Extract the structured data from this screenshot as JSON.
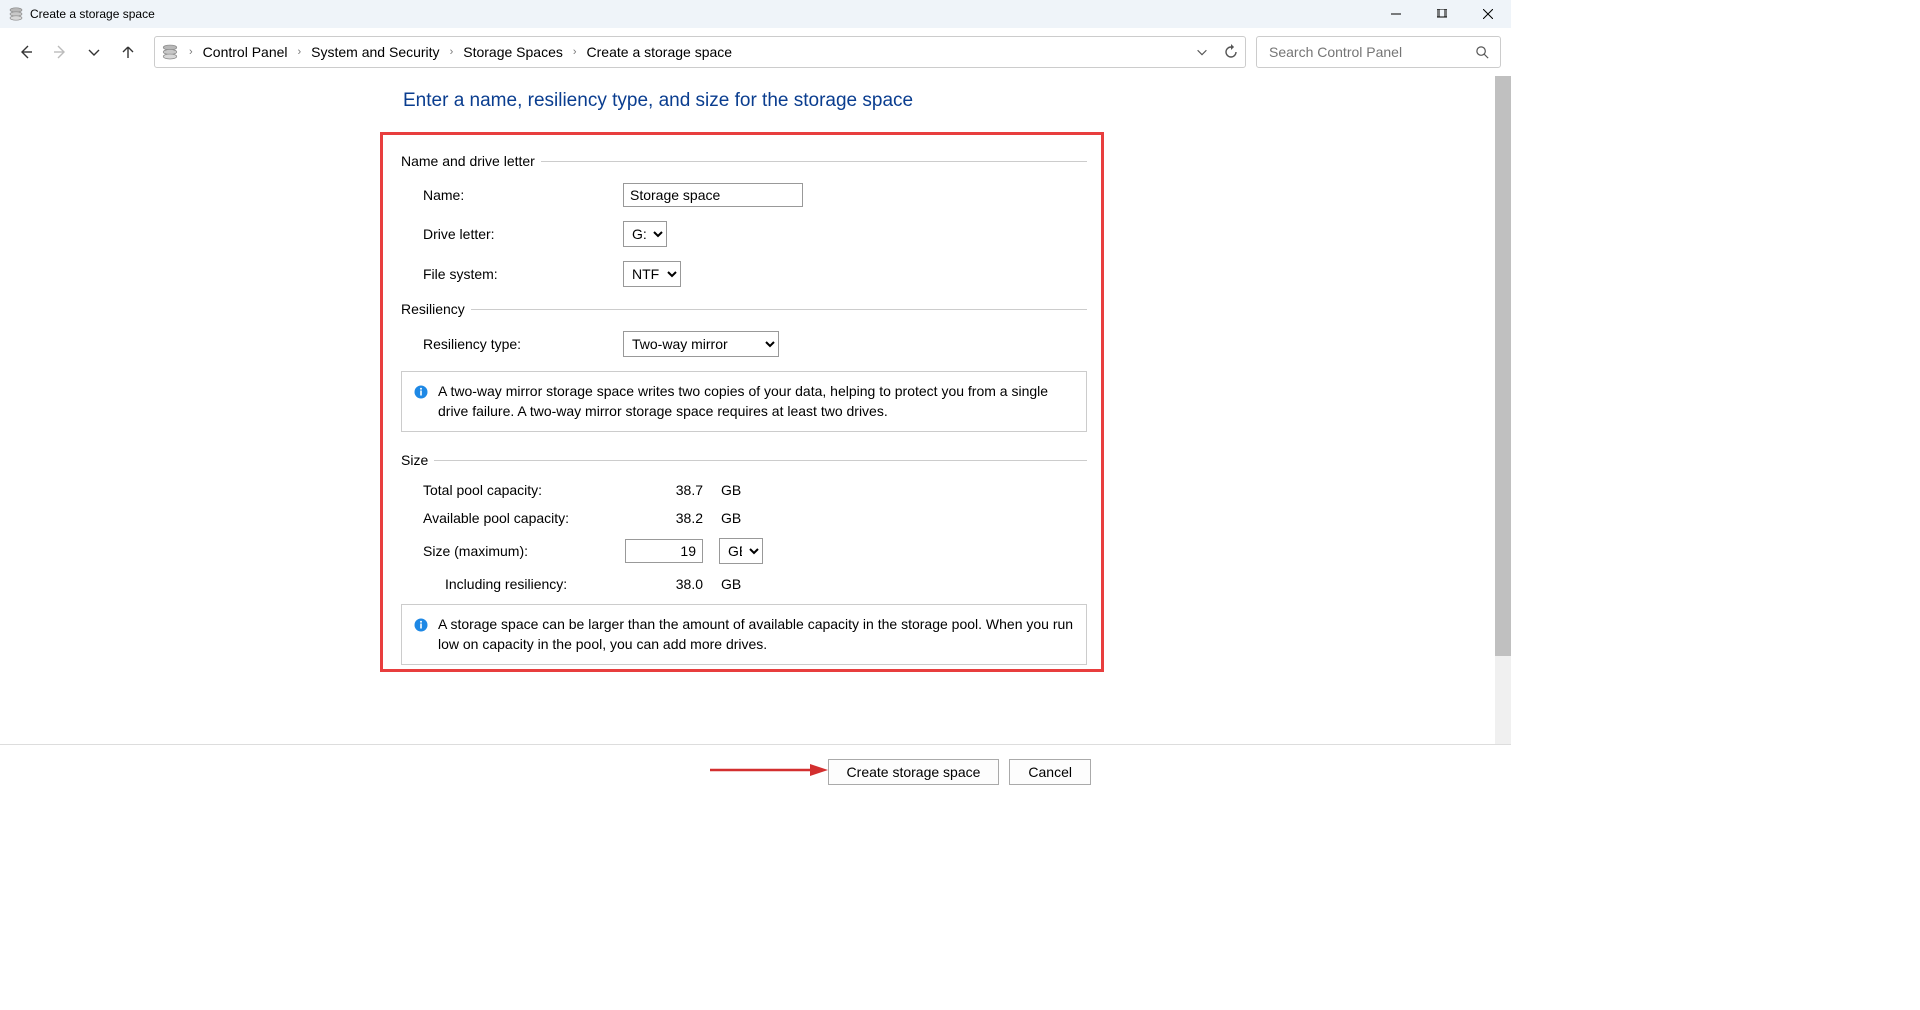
{
  "window": {
    "title": "Create a storage space"
  },
  "breadcrumb": {
    "items": [
      "Control Panel",
      "System and Security",
      "Storage Spaces",
      "Create a storage space"
    ]
  },
  "search": {
    "placeholder": "Search Control Panel"
  },
  "page": {
    "title": "Enter a name, resiliency type, and size for the storage space"
  },
  "sections": {
    "name_section": "Name and drive letter",
    "resiliency_section": "Resiliency",
    "size_section": "Size"
  },
  "form": {
    "name_label": "Name:",
    "name_value": "Storage space",
    "drive_letter_label": "Drive letter:",
    "drive_letter_value": "G:",
    "file_system_label": "File system:",
    "file_system_value": "NTFS",
    "resiliency_type_label": "Resiliency type:",
    "resiliency_type_value": "Two-way mirror",
    "resiliency_info": "A two-way mirror storage space writes two copies of your data, helping to protect you from a single drive failure. A two-way mirror storage space requires at least two drives.",
    "total_pool_label": "Total pool capacity:",
    "total_pool_value": "38.7",
    "total_pool_unit": "GB",
    "available_pool_label": "Available pool capacity:",
    "available_pool_value": "38.2",
    "available_pool_unit": "GB",
    "size_max_label": "Size (maximum):",
    "size_max_value": "19",
    "size_max_unit": "GB",
    "including_res_label": "Including resiliency:",
    "including_res_value": "38.0",
    "including_res_unit": "GB",
    "size_info": "A storage space can be larger than the amount of available capacity in the storage pool. When you run low on capacity in the pool, you can add more drives."
  },
  "footer": {
    "create_btn": "Create storage space",
    "cancel_btn": "Cancel"
  }
}
